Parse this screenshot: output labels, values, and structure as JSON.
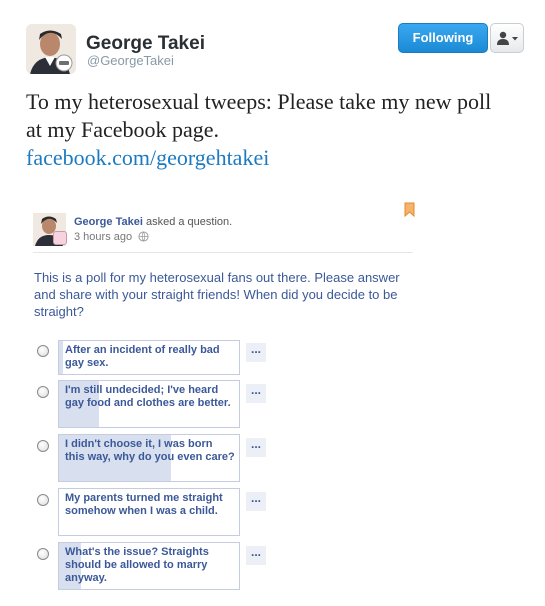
{
  "header": {
    "name": "George Takei",
    "handle": "@GeorgeTakei",
    "follow_label": "Following"
  },
  "tweet": {
    "text": "To my heterosexual tweeps: Please take my new poll at my Facebook page.",
    "link": "facebook.com/georgehtakei"
  },
  "fb_post": {
    "author": "George Takei",
    "action": "asked a question.",
    "time": "3 hours ago",
    "question": "This is a poll for my heterosexual fans out there. Please answer and share with your straight friends! When did you decide to be straight?",
    "options": [
      {
        "label": "After an incident of really bad gay sex.",
        "vote_fraction": 0.02
      },
      {
        "label": "I'm still undecided; I've heard gay food and clothes are better.",
        "vote_fraction": 0.22
      },
      {
        "label": "I didn't choose it, I was born this way, why do you even care?",
        "vote_fraction": 0.62
      },
      {
        "label": "My parents turned me straight somehow when I was a child.",
        "vote_fraction": 0.0
      },
      {
        "label": "What's the issue? Straights should be allowed to marry anyway.",
        "vote_fraction": 0.12
      }
    ],
    "more_label": "..."
  },
  "colors": {
    "follow_button": "#2b9ae2",
    "link": "#1b7ac0",
    "fb_blue": "#3b5998",
    "poll_fill": "#d8dfee"
  }
}
